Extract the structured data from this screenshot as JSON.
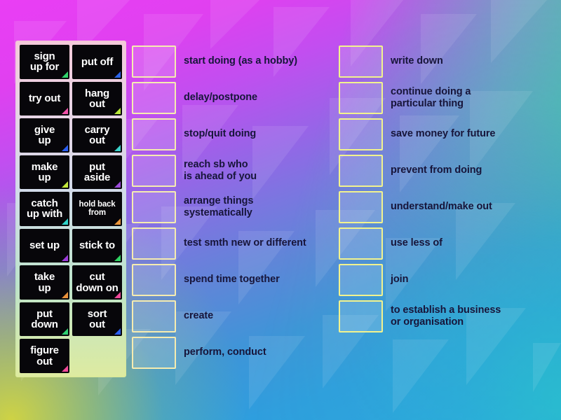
{
  "activity": {
    "type": "match-up",
    "background_colors": {
      "top_left": "#ea3ef5",
      "top_right": "#35e09a",
      "bottom_left": "#ccd03c",
      "bottom_right": "#2bbfd2",
      "middle": "#2a95de"
    }
  },
  "word_panel": {
    "border_gradient_start": "#f3c7d8",
    "border_gradient_end": "#dcea9a",
    "tiles": [
      {
        "label": "sign\nup for",
        "corner_color": "#2fd36a",
        "small": false,
        "empty": false
      },
      {
        "label": "put off",
        "corner_color": "#2a63e8",
        "small": false,
        "empty": false
      },
      {
        "label": "try out",
        "corner_color": "#f050a8",
        "small": false,
        "empty": false
      },
      {
        "label": "hang\nout",
        "corner_color": "#b8e83a",
        "small": false,
        "empty": false
      },
      {
        "label": "give\nup",
        "corner_color": "#2a5ef0",
        "small": false,
        "empty": false
      },
      {
        "label": "carry\nout",
        "corner_color": "#3ad0c8",
        "small": false,
        "empty": false
      },
      {
        "label": "make\nup",
        "corner_color": "#c2e83a",
        "small": false,
        "empty": false
      },
      {
        "label": "put\naside",
        "corner_color": "#9a4ad8",
        "small": false,
        "empty": false
      },
      {
        "label": "catch\nup with",
        "corner_color": "#2ed2c8",
        "small": false,
        "empty": false
      },
      {
        "label": "hold back\nfrom",
        "corner_color": "#e8943a",
        "small": true,
        "empty": false
      },
      {
        "label": "set up",
        "corner_color": "#9a3ad8",
        "small": false,
        "empty": false
      },
      {
        "label": "stick to",
        "corner_color": "#2ed060",
        "small": false,
        "empty": false
      },
      {
        "label": "take\nup",
        "corner_color": "#e8913a",
        "small": false,
        "empty": false
      },
      {
        "label": "cut\ndown on",
        "corner_color": "#f04898",
        "small": false,
        "empty": false
      },
      {
        "label": "put\ndown",
        "corner_color": "#2ed070",
        "small": false,
        "empty": false
      },
      {
        "label": "sort\nout",
        "corner_color": "#2a5ef0",
        "small": false,
        "empty": false
      },
      {
        "label": "figure\nout",
        "corner_color": "#f04898",
        "small": false,
        "empty": false
      },
      {
        "label": "",
        "corner_color": "",
        "small": false,
        "empty": true
      }
    ]
  },
  "definitions_middle": [
    {
      "text": "start doing (as a hobby)"
    },
    {
      "text": "delay/postpone"
    },
    {
      "text": "stop/quit doing"
    },
    {
      "text": "reach sb who\nis ahead of you"
    },
    {
      "text": "arrange things\nsystematically"
    },
    {
      "text": "test smth new or different"
    },
    {
      "text": "spend time together"
    },
    {
      "text": "create"
    },
    {
      "text": "perform, conduct"
    }
  ],
  "definitions_right": [
    {
      "text": "write down"
    },
    {
      "text": "continue doing a\nparticular thing"
    },
    {
      "text": "save money for future"
    },
    {
      "text": "prevent from doing"
    },
    {
      "text": "understand/make out"
    },
    {
      "text": "use less of"
    },
    {
      "text": "join"
    },
    {
      "text": "to establish a business\nor organisation"
    }
  ]
}
